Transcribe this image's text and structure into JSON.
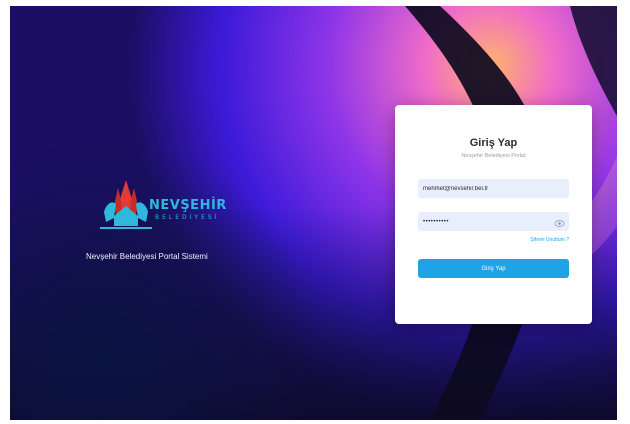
{
  "branding": {
    "logo_word": "NEVŞEHİR",
    "logo_sub": "BELEDİYESİ",
    "portal_name": "Nevşehir Belediyesi Portal Sistemi"
  },
  "login": {
    "title": "Giriş Yap",
    "subtitle": "Nevşehir Belediyesi Portal",
    "email_value": "mehmet@nevsehir.bel.tr",
    "password_value": "••••••••••",
    "forgot_label": "Şifreni Unuttum ?",
    "submit_label": "Giriş Yap"
  },
  "colors": {
    "accent": "#1ea3e7",
    "logo_blue": "#2fb7dc",
    "logo_red": "#e23a36"
  },
  "icons": [
    "logo-emblem",
    "eye-icon"
  ]
}
